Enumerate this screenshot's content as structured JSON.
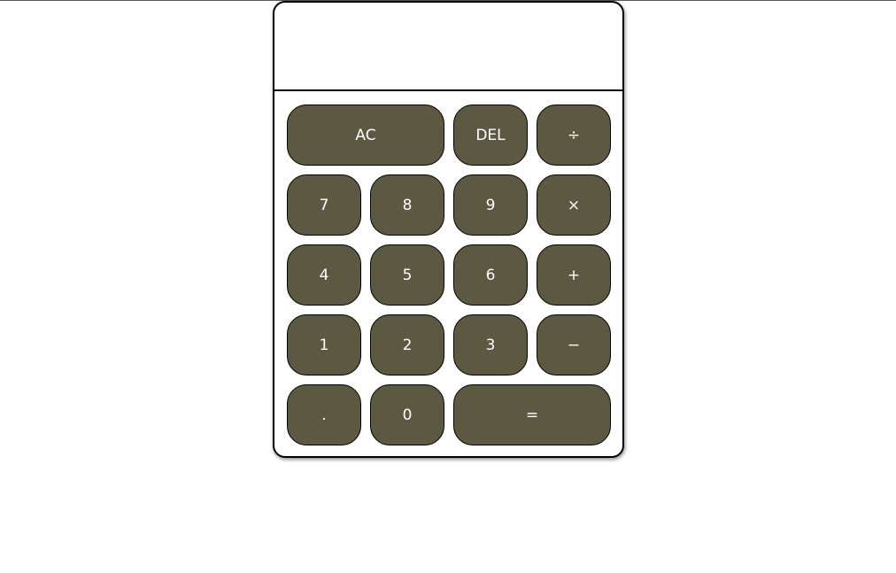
{
  "display": {
    "value": ""
  },
  "keys": {
    "all_clear": "AC",
    "delete": "DEL",
    "divide": "÷",
    "seven": "7",
    "eight": "8",
    "nine": "9",
    "multiply": "×",
    "four": "4",
    "five": "5",
    "six": "6",
    "plus": "+",
    "one": "1",
    "two": "2",
    "three": "3",
    "minus": "−",
    "decimal": ".",
    "zero": "0",
    "equals": "="
  },
  "colors": {
    "key_background": "#5c5841",
    "key_text": "#ffffff",
    "border": "#000000"
  }
}
